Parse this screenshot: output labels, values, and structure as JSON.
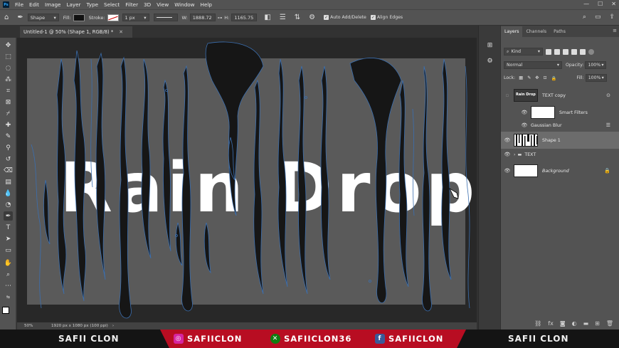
{
  "menubar": {
    "logo": "Ps",
    "items": [
      "File",
      "Edit",
      "Image",
      "Layer",
      "Type",
      "Select",
      "Filter",
      "3D",
      "View",
      "Window",
      "Help"
    ],
    "window_controls": [
      "—",
      "☐",
      "✕"
    ]
  },
  "options": {
    "mode": "Shape",
    "fill_label": "Fill:",
    "stroke_label": "Stroke:",
    "stroke_width": "1 px",
    "w_label": "W:",
    "w_value": "1888.72",
    "h_label": "H:",
    "h_value": "1165.75",
    "auto_add_delete": "Auto Add/Delete",
    "align_edges": "Align Edges"
  },
  "document": {
    "tab_title": "Untitled-1 @ 50% (Shape 1, RGB/8) *",
    "canvas_text": "Rain Drop",
    "colors": {
      "canvas": "#5a5a5a",
      "drips": "#161616",
      "path": "#3b6fb0",
      "text": "#ffffff"
    }
  },
  "status": {
    "zoom": "50%",
    "info": "1920 px x 1080 px (100 ppi)"
  },
  "panel": {
    "tabs": [
      "Layers",
      "Channels",
      "Paths"
    ],
    "kind": "Kind",
    "blend": "Normal",
    "opacity_label": "Opacity:",
    "opacity_value": "100%",
    "lock_label": "Lock:",
    "fill_label": "Fill:",
    "fill_value": "100%",
    "layers": {
      "text_copy": "TEXT copy",
      "text_copy_thumb": "Rain Drop",
      "smart_filters": "Smart Filters",
      "gaussian_blur": "Gaussian Blur",
      "shape1": "Shape 1",
      "text_group": "TEXT",
      "background": "Background"
    }
  },
  "banner": {
    "left_name": "SAFII CLON",
    "instagram": "SAFIICLON",
    "xbox": "SAFIICLON36",
    "facebook": "SAFIICLON",
    "right_name": "SAFII CLON"
  }
}
